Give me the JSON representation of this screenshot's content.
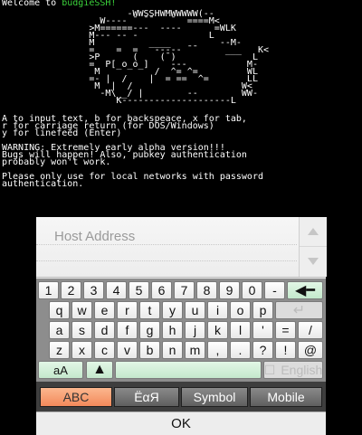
{
  "terminal": {
    "welcome_prefix": "Welcome to ",
    "welcome_brand": "budgieSSH!",
    "ascii_art": "                       -WWSSHWMWWWWW(--\n                  W---- ¯ ¯¯   ¯  ====M<\n                >M======---  ----      =WLK\n                M--- -- -             L\n                M          ____         --M-\n                =    =  =   ----- ¯¯     ___   K<\n                >P      (    (¯)              L\n                =  P[_o_o_]    ---           M-\n                 M          /  ^= ^=         WL\n                =- |  /    |  = ==  ^=       LL\n                 M  |  /                    W<\n                  -M\\__/ |        --        WW-\n                     K--------------------L",
    "help_text": "A to input text, b for backspeace, x for tab,\nr for carriage return (for DOS/Windows)\ny for linefeed (Enter)",
    "warning_text": "WARNING: Extremely early alpha version!!!\nBugs will happen! Also, pubkey authentication\nprobably won't work.",
    "note_text": "Please only use for local networks with password\nauthentication."
  },
  "input": {
    "placeholder": "Host Address",
    "value": ""
  },
  "keyboard": {
    "row1": [
      "1",
      "2",
      "3",
      "4",
      "5",
      "6",
      "7",
      "8",
      "9",
      "0",
      "-"
    ],
    "row2": [
      "q",
      "w",
      "e",
      "r",
      "t",
      "y",
      "u",
      "i",
      "o",
      "p"
    ],
    "row3": [
      "a",
      "s",
      "d",
      "f",
      "g",
      "h",
      "j",
      "k",
      "l",
      "'",
      "=",
      "/"
    ],
    "row4": [
      "z",
      "x",
      "c",
      "v",
      "b",
      "n",
      "m",
      ",",
      ".",
      "?",
      "!",
      "@"
    ],
    "backspace_icon": "left-arrow",
    "enter_icon": "return-arrow",
    "shift_icon": "up-arrow",
    "case_toggle_label": "aA",
    "language_label": "English"
  },
  "modes": {
    "tabs": [
      "ABC",
      "ËαЯ",
      "Symbol",
      "Mobile"
    ],
    "active": "ABC"
  },
  "ok_label": "OK",
  "colors": {
    "brand_green": "#3bd23b",
    "active_tab": "#f3895a",
    "green_key": "#c4e8cc"
  }
}
